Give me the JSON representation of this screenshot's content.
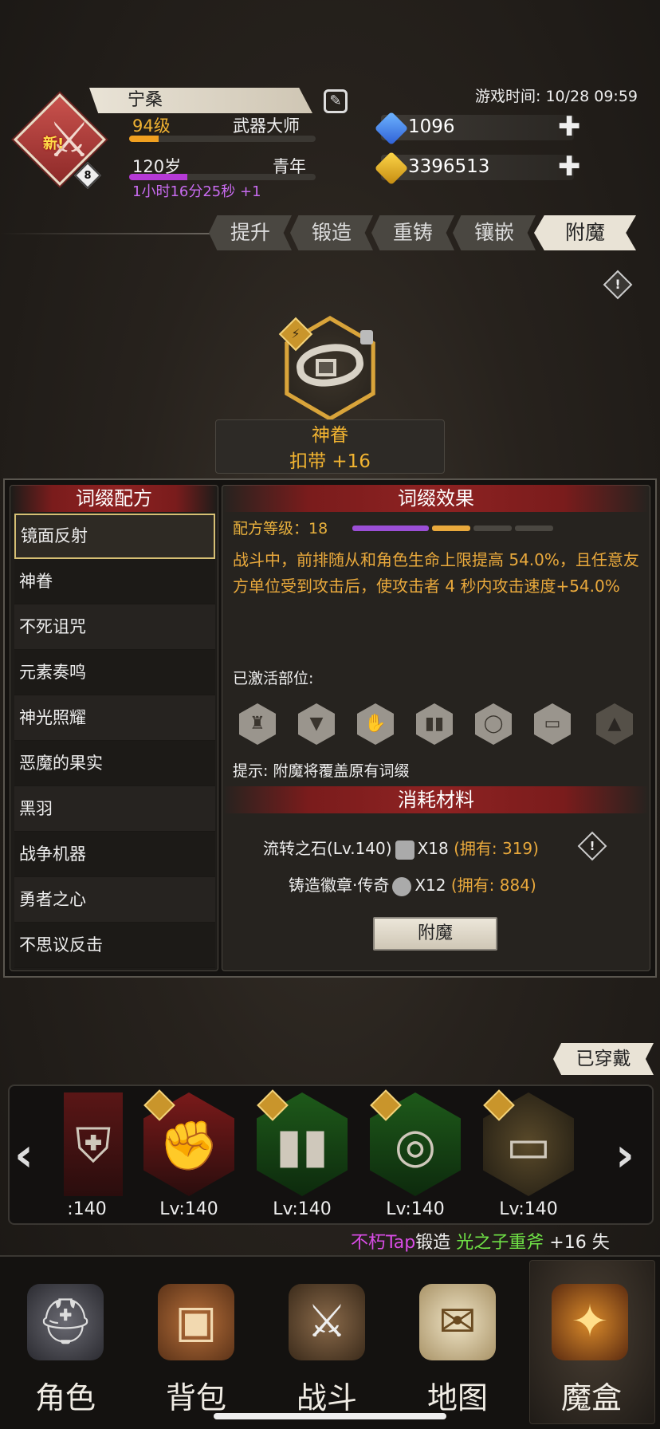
{
  "header": {
    "player_name": "宁桑",
    "new_badge": "新!",
    "avatar_level": "8",
    "level": "94级",
    "class": "武器大师",
    "level_progress": 0.16,
    "age": "120岁",
    "life_stage": "青年",
    "age_progress": 0.31,
    "age_timer": "1小时16分25秒 +1",
    "game_time": "游戏时间: 10/28 09:59",
    "gems": "1096",
    "gold": "3396513"
  },
  "tabs": [
    {
      "label": "提升",
      "active": false
    },
    {
      "label": "锻造",
      "active": false
    },
    {
      "label": "重铸",
      "active": false
    },
    {
      "label": "镶嵌",
      "active": false
    },
    {
      "label": "附魔",
      "active": true
    }
  ],
  "item": {
    "enchant_name": "神眷",
    "name": "扣带 +16"
  },
  "recipes": {
    "title": "词缀配方",
    "items": [
      "镜面反射",
      "神眷",
      "不死诅咒",
      "元素奏鸣",
      "神光照耀",
      "恶魔的果实",
      "黑羽",
      "战争机器",
      "勇者之心",
      "不思议反击"
    ],
    "selected_index": 0
  },
  "effect": {
    "title": "词缀效果",
    "recipe_level": "配方等级：18",
    "description": "战斗中，前排随从和角色生命上限提高 54.0%，且任意友方单位受到攻击后，使攻击者 4 秒内攻击速度+54.0%",
    "activated_label": "已激活部位:",
    "slots": [
      "helmet-icon",
      "armor-icon",
      "glove-icon",
      "boots-icon",
      "ring-icon",
      "belt-icon",
      "cloak-icon"
    ],
    "hint": "提示: 附魔将覆盖原有词缀"
  },
  "materials": {
    "title": "消耗材料",
    "rows": [
      {
        "name": "流转之石(Lv.140)",
        "qty": "X18",
        "owned": "(拥有: 319)"
      },
      {
        "name": "铸造徽章·传奇",
        "qty": "X12",
        "owned": "(拥有: 884)"
      }
    ],
    "button": "附魔"
  },
  "equipment": {
    "equipped_label": "已穿戴",
    "items": [
      {
        "lv": ":140",
        "frame": "red"
      },
      {
        "lv": "Lv:140",
        "frame": "red"
      },
      {
        "lv": "Lv:140",
        "frame": "green"
      },
      {
        "lv": "Lv:140",
        "frame": "green"
      },
      {
        "lv": "Lv:140",
        "frame": "gold"
      }
    ]
  },
  "ticker": {
    "player": "不朽Tap",
    "action": "锻造",
    "item": "光之子重斧",
    "suffix": "+16 失"
  },
  "nav": [
    {
      "label": "角色",
      "icon": "helmet-icon"
    },
    {
      "label": "背包",
      "icon": "backpack-icon"
    },
    {
      "label": "战斗",
      "icon": "sword-shield-icon"
    },
    {
      "label": "地图",
      "icon": "scroll-map-icon"
    },
    {
      "label": "魔盒",
      "icon": "magic-box-icon"
    }
  ],
  "colors": {
    "gold": "#f2b431",
    "accent_red": "#8e2222",
    "purple": "#b53ad6"
  }
}
